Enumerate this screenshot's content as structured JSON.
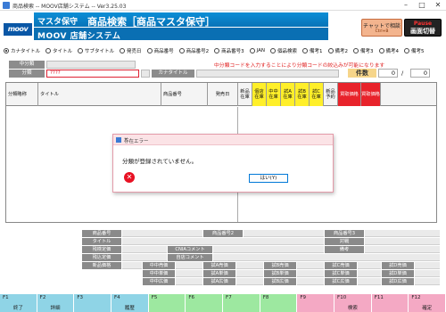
{
  "window": {
    "title": "商品検索 -- MOOV店舗システム -- Ver3.25.03",
    "min": "–",
    "max": "□",
    "close": "✕"
  },
  "header": {
    "logo": "moov",
    "system_name": "マスタ保守",
    "screen_title": "商品検索［商品マスタ保守］",
    "subtitle": "MOOV 店舗システム",
    "chat_button": {
      "line1": "チャットで相談",
      "line2": "Ctrl+B"
    },
    "pause_button": {
      "line1": "Pause",
      "line2": "画面切替"
    }
  },
  "search_modes": [
    {
      "label": "カナタイトル",
      "selected": true
    },
    {
      "label": "タイトル",
      "selected": false
    },
    {
      "label": "サブタイトル",
      "selected": false
    },
    {
      "label": "発売日",
      "selected": false
    },
    {
      "label": "商品番号",
      "selected": false
    },
    {
      "label": "商品番号2",
      "selected": false
    },
    {
      "label": "商品番号3",
      "selected": false
    },
    {
      "label": "JAN",
      "selected": false
    },
    {
      "label": "個品検索",
      "selected": false
    },
    {
      "label": "備考1",
      "selected": false
    },
    {
      "label": "備考2",
      "selected": false
    },
    {
      "label": "備考3",
      "selected": false
    },
    {
      "label": "備考4",
      "selected": false
    },
    {
      "label": "備考5",
      "selected": false
    }
  ],
  "filters": {
    "chubunrui_label": "中分類",
    "bunrui_label": "分類",
    "bunrui_value": "????",
    "kana_title_label": "カナタイトル",
    "notice": "中分類コードを入力することにより分類コードの絞込みが可能になります",
    "count_label": "件数",
    "count_current": "0",
    "count_separator": "/",
    "count_total": "0"
  },
  "grid": {
    "headers": [
      {
        "label": "分類略称",
        "style": "left"
      },
      {
        "label": "タイトル",
        "style": "left"
      },
      {
        "label": "商品番号",
        "style": "left"
      },
      {
        "label": "発売日",
        "style": "plain"
      },
      {
        "label": "新品 在庫",
        "style": "plain"
      },
      {
        "label": "個店 在庫",
        "style": "yel"
      },
      {
        "label": "中中 在庫",
        "style": "yel"
      },
      {
        "label": "試A 在庫",
        "style": "yel"
      },
      {
        "label": "試B 在庫",
        "style": "yel"
      },
      {
        "label": "試C 在庫",
        "style": "yel"
      },
      {
        "label": "新品 予約",
        "style": "plain"
      },
      {
        "label": "買取価格",
        "style": "red"
      },
      {
        "label": "買取価格",
        "style": "red"
      }
    ]
  },
  "dialog": {
    "title": "存在エラー",
    "message": "分類が登録されていません。",
    "ok_button": "はい(Y)",
    "close": "✕"
  },
  "details": {
    "labels": {
      "hinmei": "商品番号",
      "title": "タイトル",
      "zaiko_tei": "残検定価",
      "zan_tei": "残込定価",
      "shinpin_price": "新品価格",
      "hin2": "商品番号2",
      "cnia": "CNIAコメント",
      "jiten": "自店コメント",
      "hin3": "商品番号3",
      "taisaku": "対戦",
      "bikou": "備考",
      "chu_baika": "中中売価",
      "chu_kaitori": "中中単価",
      "chu_kouka": "中中広価",
      "sa_baika": "試A売価",
      "sa_kaitori": "試A単価",
      "sa_kouka": "試A広価",
      "sb_baika": "試B売価",
      "sb_kaitori": "試B単価",
      "sb_kouka": "試B広価",
      "sc_baika": "試C売価",
      "sc_kaitori": "試C単価",
      "sc_kouka": "試C広価",
      "sd_baika": "試D売価",
      "sd_kaitori": "試D単価",
      "sd_kouka": "試D広価"
    }
  },
  "function_keys": [
    {
      "key": "F1",
      "label": "終了",
      "color": "#8fd4e6"
    },
    {
      "key": "F2",
      "label": "詳細",
      "color": "#8fd4e6"
    },
    {
      "key": "F3",
      "label": "",
      "color": "#8fd4e6"
    },
    {
      "key": "F4",
      "label": "履歴",
      "color": "#8fd4e6"
    },
    {
      "key": "F5",
      "label": "",
      "color": "#9de8a0"
    },
    {
      "key": "F6",
      "label": "",
      "color": "#9de8a0"
    },
    {
      "key": "F7",
      "label": "",
      "color": "#9de8a0"
    },
    {
      "key": "F8",
      "label": "",
      "color": "#9de8a0"
    },
    {
      "key": "F9",
      "label": "",
      "color": "#f4a9c4"
    },
    {
      "key": "F10",
      "label": "検索",
      "color": "#f4a9c4"
    },
    {
      "key": "F11",
      "label": "",
      "color": "#f4a9c4"
    },
    {
      "key": "F12",
      "label": "確定",
      "color": "#f4a9c4"
    }
  ]
}
